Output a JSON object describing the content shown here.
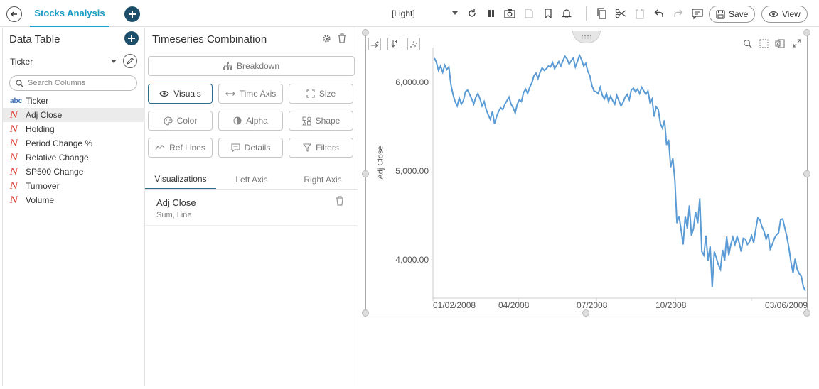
{
  "header": {
    "tab_label": "Stocks Analysis",
    "theme_label": "[Light]",
    "save_label": "Save",
    "view_label": "View"
  },
  "left_panel": {
    "title": "Data Table",
    "ticker_label": "Ticker",
    "search_placeholder": "Search Columns",
    "columns": [
      {
        "type": "abc",
        "label": "Ticker",
        "active": false
      },
      {
        "type": "numeric",
        "label": "Adj Close",
        "active": true
      },
      {
        "type": "numeric",
        "label": "Holding",
        "active": false
      },
      {
        "type": "numeric",
        "label": "Period Change %",
        "active": false
      },
      {
        "type": "numeric",
        "label": "Relative Change",
        "active": false
      },
      {
        "type": "numeric",
        "label": "SP500 Change",
        "active": false
      },
      {
        "type": "numeric",
        "label": "Turnover",
        "active": false
      },
      {
        "type": "numeric",
        "label": "Volume",
        "active": false
      }
    ]
  },
  "middle_panel": {
    "title": "Timeseries Combination",
    "breakdown_label": "Breakdown",
    "buttons": {
      "visuals": "Visuals",
      "time_axis": "Time Axis",
      "size": "Size",
      "color": "Color",
      "alpha": "Alpha",
      "shape": "Shape",
      "ref_lines": "Ref Lines",
      "details": "Details",
      "filters": "Filters"
    },
    "tabs": [
      "Visualizations",
      "Left Axis",
      "Right Axis"
    ],
    "visualization": {
      "name": "Adj Close",
      "subtitle": "Sum, Line"
    }
  },
  "chart_data": {
    "type": "line",
    "ylabel": "Adj Close",
    "yticks": [
      "6,000.00",
      "5,000.00",
      "4,000.00"
    ],
    "ytick_values": [
      6000,
      5000,
      4000
    ],
    "xticks": [
      "01/02/2008",
      "04/2008",
      "07/2008",
      "10/2008",
      "03/06/2009"
    ],
    "ylim": [
      3600,
      6350
    ],
    "line_color": "#5b9bd5",
    "series": [
      {
        "values": [
          6280,
          6230,
          6140,
          6190,
          6120,
          6200,
          6150,
          6180,
          5980,
          5870,
          5790,
          5740,
          5830,
          5760,
          5800,
          5900,
          5920,
          5870,
          5820,
          5760,
          5840,
          5880,
          5820,
          5740,
          5790,
          5700,
          5640,
          5590,
          5680,
          5540,
          5620,
          5680,
          5720,
          5700,
          5760,
          5800,
          5840,
          5760,
          5720,
          5660,
          5760,
          5810,
          5790,
          5890,
          5930,
          5880,
          5950,
          6000,
          6080,
          6110,
          6050,
          6120,
          6170,
          6140,
          6160,
          6190,
          6180,
          6230,
          6160,
          6200,
          6240,
          6190,
          6250,
          6300,
          6270,
          6210,
          6250,
          6280,
          6180,
          6240,
          6310,
          6260,
          6190,
          6220,
          6130,
          6080,
          5970,
          5910,
          5900,
          5880,
          5950,
          5860,
          5820,
          5880,
          5790,
          5850,
          5800,
          5760,
          5860,
          5800,
          5740,
          5780,
          5840,
          5870,
          5810,
          5920,
          5940,
          5900,
          5930,
          5880,
          5950,
          5910,
          5870,
          5910,
          5780,
          5820,
          5620,
          5730,
          5700,
          5540,
          5490,
          5580,
          5300,
          5360,
          5050,
          5150,
          4900,
          4420,
          4500,
          4350,
          4180,
          4500,
          4360,
          4620,
          4280,
          4360,
          4550,
          4420,
          4700,
          4100,
          4060,
          4280,
          4000,
          4160,
          3700,
          4100,
          4030,
          3950,
          3900,
          4120,
          4000,
          4270,
          4060,
          4180,
          4260,
          4180,
          4270,
          4200,
          4100,
          4250,
          4240,
          4180,
          4210,
          4280,
          4200,
          4350,
          4480,
          4460,
          4380,
          4330,
          4240,
          4300,
          4130,
          4180,
          4250,
          4290,
          4310,
          4460,
          4470,
          4370,
          4270,
          4140,
          3980,
          3860,
          4020,
          3900,
          3850,
          3820,
          3700,
          3660
        ]
      }
    ]
  },
  "colors": {
    "accent": "#1fa3c9",
    "dark_button": "#1d4f6b",
    "selected_border": "#2e6b88",
    "numeric_type": "#e0413a",
    "abc_type": "#3b6db3"
  }
}
